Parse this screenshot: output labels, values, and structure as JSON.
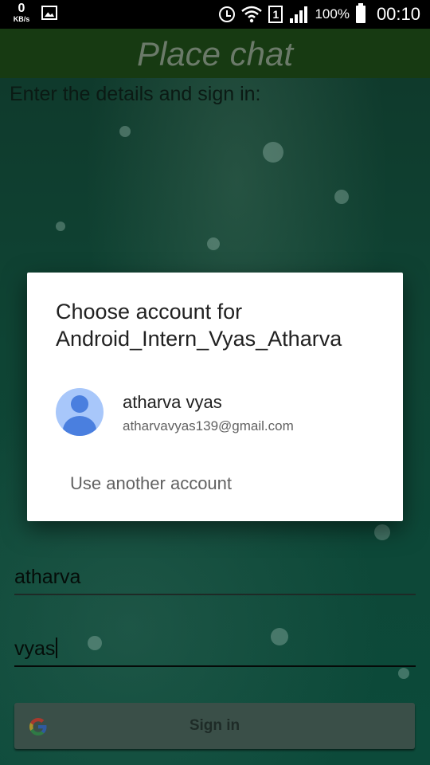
{
  "status_bar": {
    "speed_value": "0",
    "speed_unit": "KB/s",
    "battery_percent": "100%",
    "time": "00:10",
    "sim_slot": "1"
  },
  "app_bar": {
    "title": "Place chat"
  },
  "main": {
    "prompt": "Enter the details and sign in:",
    "first_name_value": "atharva",
    "last_name_value": "vyas",
    "signin_label": "Sign in"
  },
  "dialog": {
    "title_line1": "Choose account for",
    "title_line2": "Android_Intern_Vyas_Atharva",
    "account_name": "atharva vyas",
    "account_email": "atharvavyas139@gmail.com",
    "another_account": "Use another account"
  },
  "colors": {
    "app_bar": "#173a12",
    "background": "#0f4535",
    "dialog": "#ffffff",
    "avatar": "#a8c7fa"
  }
}
